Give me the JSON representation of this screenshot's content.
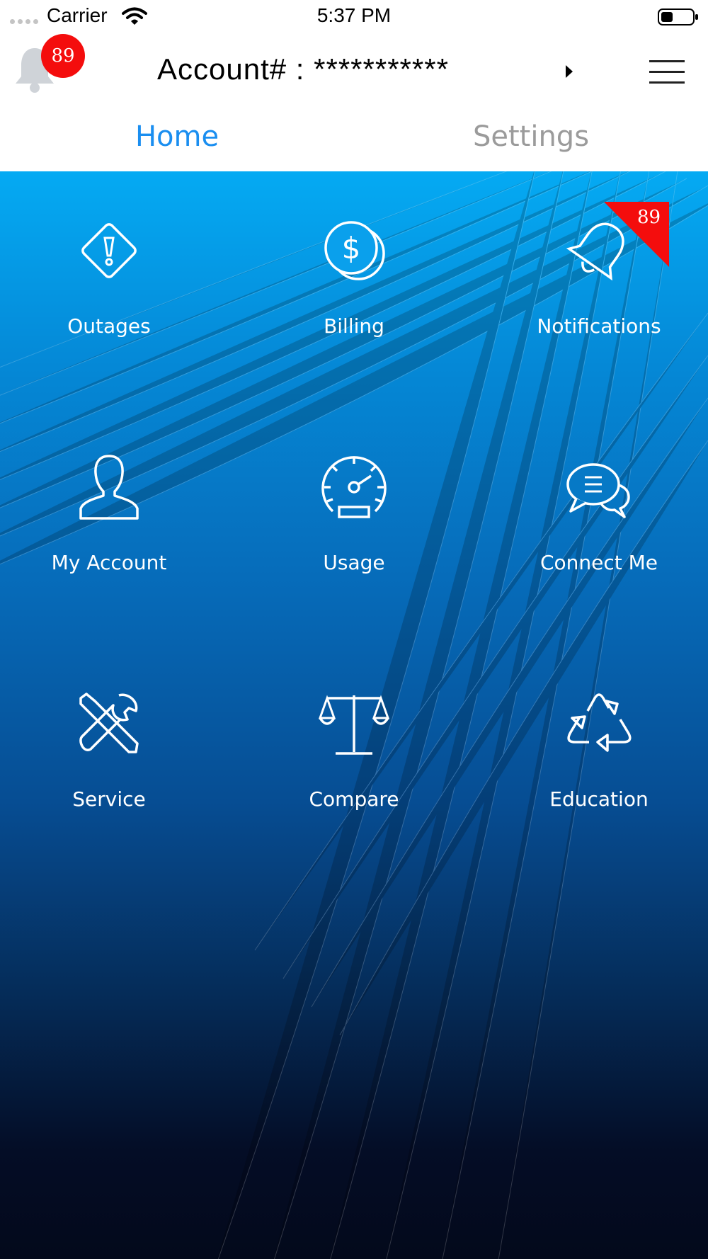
{
  "status_bar": {
    "carrier": "Carrier",
    "time": "5:37 PM",
    "icons": [
      "signal-dots-icon",
      "wifi-icon",
      "battery-icon"
    ]
  },
  "header": {
    "notification_badge_count": "89",
    "account_label": "Account# : ***********",
    "icons": [
      "bell-icon",
      "caret-right-icon",
      "hamburger-menu-icon"
    ]
  },
  "tabs": [
    {
      "label": "Home",
      "active": true
    },
    {
      "label": "Settings",
      "active": false
    }
  ],
  "tiles": [
    {
      "label": "Outages",
      "icon": "warning-diamond-icon"
    },
    {
      "label": "Billing",
      "icon": "dollar-coin-icon"
    },
    {
      "label": "Notifications",
      "icon": "bell-icon",
      "badge": "89"
    },
    {
      "label": "My Account",
      "icon": "user-icon"
    },
    {
      "label": "Usage",
      "icon": "speedometer-icon"
    },
    {
      "label": "Connect Me",
      "icon": "chat-bubbles-icon"
    },
    {
      "label": "Service",
      "icon": "wrench-screwdriver-icon"
    },
    {
      "label": "Compare",
      "icon": "balance-scale-icon"
    },
    {
      "label": "Education",
      "icon": "recycle-icon"
    }
  ],
  "colors": {
    "accent": "#1a8ef0",
    "inactive_tab": "#9b9b9b",
    "badge_red": "#f40d0d",
    "gradient_top": "#05aaf3",
    "gradient_bottom": "#03091b"
  }
}
